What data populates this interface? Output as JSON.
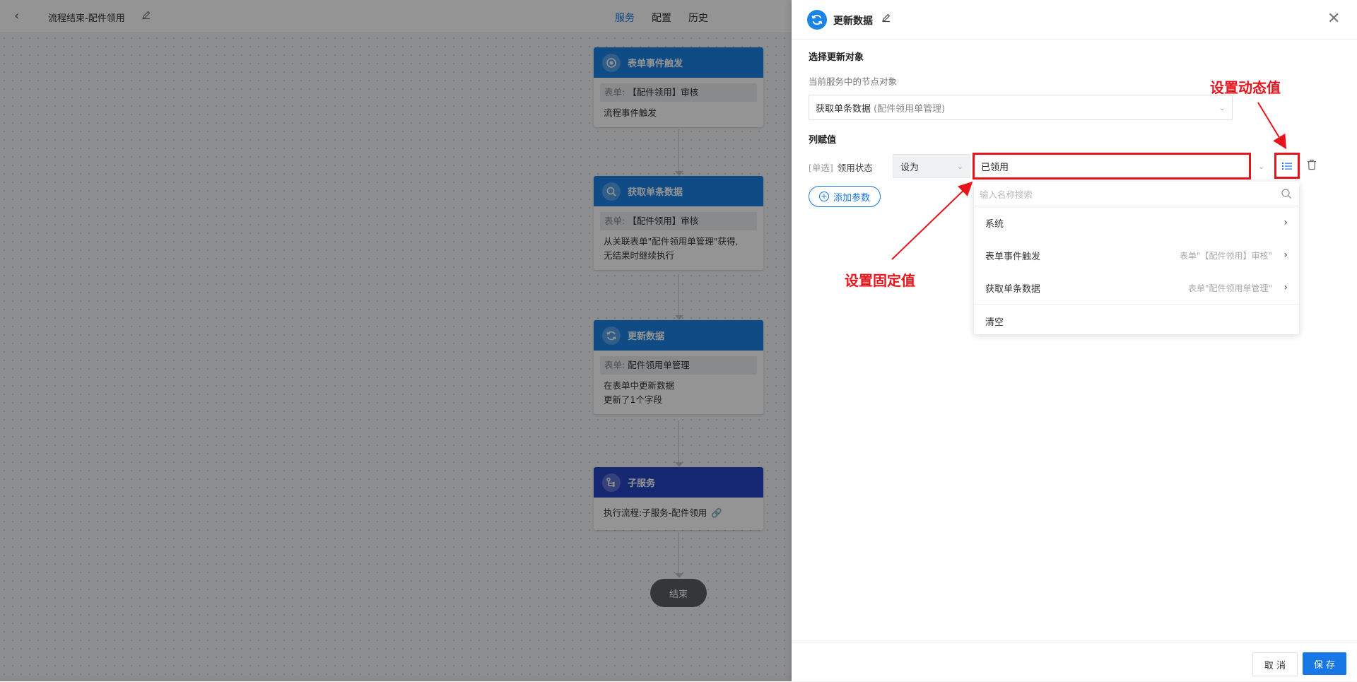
{
  "topbar": {
    "back_icon": "chevron-left-icon",
    "title": "流程结束-配件领用",
    "tabs": [
      {
        "label": "服务",
        "active": true
      },
      {
        "label": "配置",
        "active": false
      },
      {
        "label": "历史",
        "active": false
      }
    ]
  },
  "flow": {
    "nodes": [
      {
        "title": "表单事件触发",
        "icon": "target-icon",
        "tag_key": "表单:",
        "tag_value": "【配件领用】审核",
        "lines": [
          "流程事件触发"
        ]
      },
      {
        "title": "获取单条数据",
        "icon": "search-icon",
        "tag_key": "表单:",
        "tag_value": "【配件领用】审核",
        "lines": [
          "从关联表单\"配件领用单管理\"获得,",
          "无结果时继续执行"
        ]
      },
      {
        "title": "更新数据",
        "icon": "refresh-icon",
        "tag_key": "表单:",
        "tag_value": "配件领用单管理",
        "lines": [
          "在表单中更新数据",
          "更新了1个字段"
        ]
      },
      {
        "title": "子服务",
        "icon": "subflow-icon",
        "exec": "执行流程:子服务-配件领用"
      }
    ],
    "end_label": "结束"
  },
  "drawer": {
    "title": "更新数据",
    "select_target_title": "选择更新对象",
    "current_node_label": "当前服务中的节点对象",
    "target_select": {
      "value": "获取单条数据",
      "muted": "(配件领用单管理)"
    },
    "assign_title": "列赋值",
    "row": {
      "type_tag": "[单选]",
      "field": "领用状态",
      "op": "设为",
      "value": "已领用"
    },
    "add_param_label": "添加参数",
    "dropdown": {
      "search_placeholder": "输入名称搜索",
      "items": [
        {
          "label": "系统",
          "hint": ""
        },
        {
          "label": "表单事件触发",
          "hint": "表单\"【配件领用】审核\""
        },
        {
          "label": "获取单条数据",
          "hint": "表单\"配件领用单管理\""
        }
      ],
      "clear_label": "清空"
    },
    "annotations": {
      "dynamic": "设置动态值",
      "fixed": "设置固定值"
    },
    "footer": {
      "cancel": "取 消",
      "save": "保 存"
    }
  },
  "colors": {
    "primary": "#1677e5",
    "annotation": "#e8141b",
    "node_head": "#1a83e6",
    "sub_node_head": "#2645c4"
  }
}
